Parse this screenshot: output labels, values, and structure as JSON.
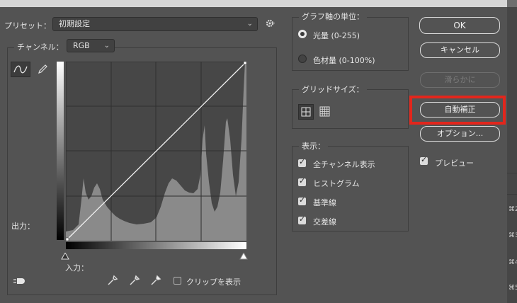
{
  "preset": {
    "label": "プリセット：",
    "value": "初期設定"
  },
  "channel": {
    "label": "チャンネル：",
    "value": "RGB"
  },
  "graph": {
    "output_label": "出力：",
    "input_label": "入力："
  },
  "clip": {
    "label": "クリップを表示",
    "checked": false
  },
  "units": {
    "title": "グラフ軸の単位：",
    "options": [
      {
        "label": "光量 (0-255)",
        "selected": true
      },
      {
        "label": "色材量 (0-100%)",
        "selected": false
      }
    ]
  },
  "grid_size": {
    "title": "グリッドサイズ："
  },
  "show": {
    "title": "表示：",
    "items": [
      {
        "label": "全チャンネル表示",
        "checked": true
      },
      {
        "label": "ヒストグラム",
        "checked": true
      },
      {
        "label": "基準線",
        "checked": true
      },
      {
        "label": "交差線",
        "checked": true
      }
    ]
  },
  "buttons": {
    "ok": "OK",
    "cancel": "キャンセル",
    "smooth": "滑らかに",
    "auto": "自動補正",
    "options": "オプション..."
  },
  "preview": {
    "label": "プレビュー",
    "checked": true
  },
  "right_strip": [
    "⌘2",
    "⌘3",
    "⌘4",
    "⌘5"
  ],
  "colors": {
    "highlight": "#e3261c",
    "panel": "#535353",
    "graph_bg": "#474747",
    "histogram": "#8a8a8a"
  }
}
